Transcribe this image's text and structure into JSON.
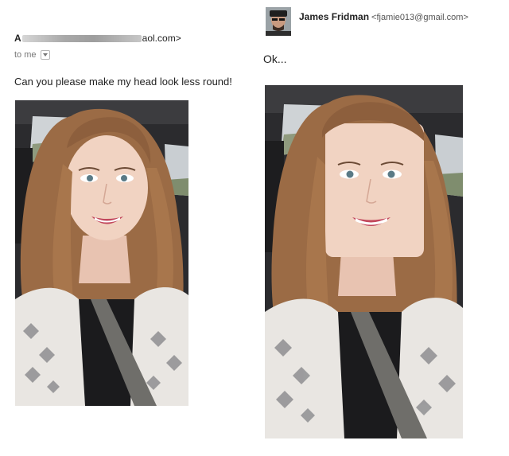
{
  "original_email": {
    "sender_initial": "A",
    "sender_suffix": "aol.com>",
    "recipient": "to me",
    "message": "Can you please make my head look less round!"
  },
  "reply_email": {
    "sender_name": "James Fridman",
    "sender_email": "<fjamie013@gmail.com>",
    "message": "Ok..."
  },
  "colors": {
    "hair": "#9b6b45",
    "skin": "#f1d3c2",
    "lips": "#c2485d",
    "cardigan": "#e9e6e2",
    "car_interior": "#2a2a2c"
  },
  "icons": {
    "recipient_dropdown": "chevron-down-icon",
    "avatar": "avatar"
  }
}
